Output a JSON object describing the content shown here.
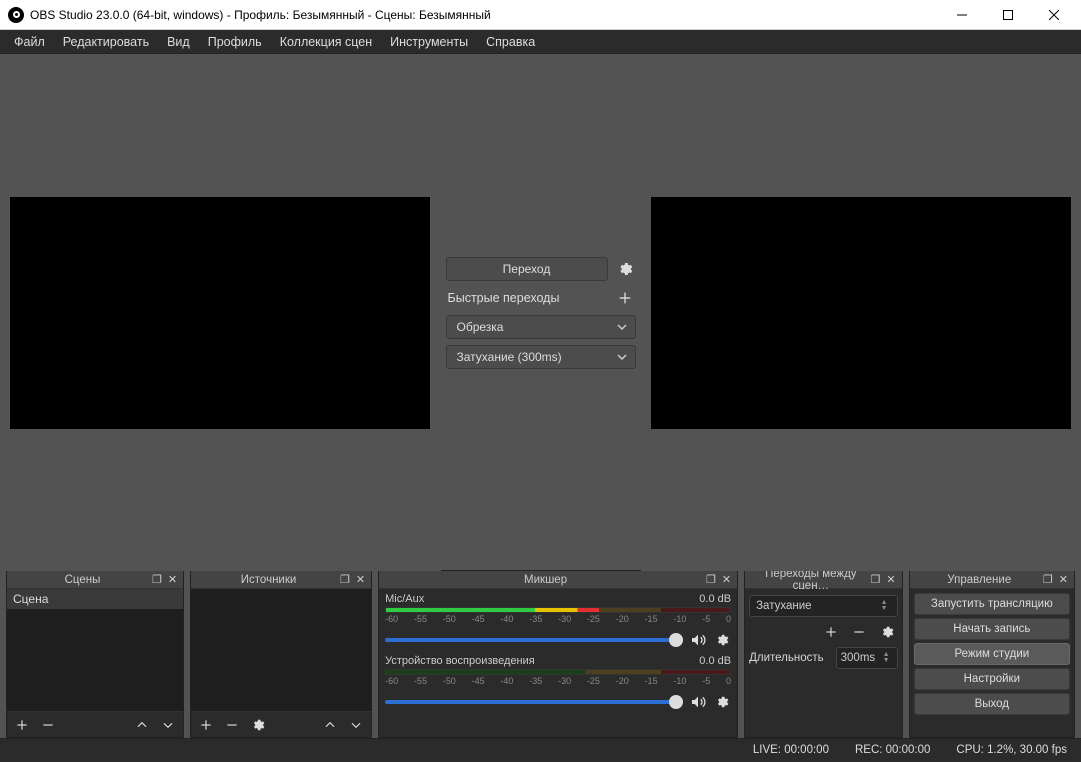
{
  "window": {
    "title": "OBS Studio 23.0.0 (64-bit, windows) - Профиль: Безымянный - Сцены: Безымянный"
  },
  "menubar": {
    "items": [
      "Файл",
      "Редактировать",
      "Вид",
      "Профиль",
      "Коллекция сцен",
      "Инструменты",
      "Справка"
    ]
  },
  "studio": {
    "transition_button": "Переход",
    "quick_transitions_label": "Быстрые переходы",
    "quick_options": [
      "Обрезка",
      "Затухание (300ms)"
    ]
  },
  "docks": {
    "scenes": {
      "title": "Сцены",
      "items": [
        "Сцена"
      ]
    },
    "sources": {
      "title": "Источники"
    },
    "mixer": {
      "title": "Микшер",
      "channels": [
        {
          "name": "Mic/Aux",
          "level": "0.0 dB",
          "ticks": [
            "-60",
            "-55",
            "-50",
            "-45",
            "-40",
            "-35",
            "-30",
            "-25",
            "-20",
            "-15",
            "-10",
            "-5",
            "0"
          ]
        },
        {
          "name": "Устройство воспроизведения",
          "level": "0.0 dB",
          "ticks": [
            "-60",
            "-55",
            "-50",
            "-45",
            "-40",
            "-35",
            "-30",
            "-25",
            "-20",
            "-15",
            "-10",
            "-5",
            "0"
          ]
        }
      ]
    },
    "transitions": {
      "title": "Переходы между сцен…",
      "selected": "Затухание",
      "duration_label": "Длительность",
      "duration_value": "300ms"
    },
    "controls": {
      "title": "Управление",
      "buttons": [
        "Запустить трансляцию",
        "Начать запись",
        "Режим студии",
        "Настройки",
        "Выход"
      ],
      "active_index": 2
    }
  },
  "statusbar": {
    "live": "LIVE: 00:00:00",
    "rec": "REC: 00:00:00",
    "cpu": "CPU: 1.2%, 30.00 fps"
  },
  "icons": {
    "gear": "gear",
    "plus": "plus",
    "minus": "minus",
    "up": "up",
    "down": "down",
    "chevron_down": "chevron-down",
    "speaker": "speaker",
    "popout": "popout",
    "close": "close"
  }
}
